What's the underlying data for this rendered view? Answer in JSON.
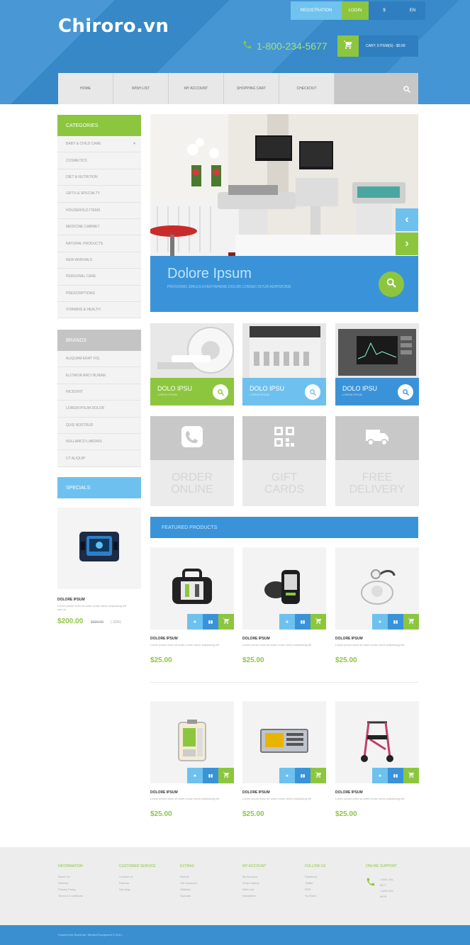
{
  "brand": "Chiroro.vn",
  "topbar": {
    "register": "REGISTRATION",
    "login": "LOGIN",
    "currency": "$",
    "language": "EN"
  },
  "header": {
    "phone": "1-800-234-5677",
    "cart_summary": "CART: 0 ITEM(S) - $0.00"
  },
  "nav": {
    "items": [
      "HOME",
      "WISH LIST",
      "MY ACCOUNT",
      "SHOPPING CART",
      "CHECKOUT"
    ]
  },
  "categories": {
    "title": "CATEGORIES",
    "items": [
      "BABY & CHILD CARE",
      "COSMETICS",
      "DIET & NUTRITION",
      "GIFTS & SPECIALTY",
      "HOUSEHOLD ITEMS",
      "MEDICINE CABINET",
      "NATURAL PRODUCTS",
      "NEW ARRIVALS",
      "PERSONAL CARE",
      "PRESCRIPTIONS",
      "VITAMINS & HEALTH"
    ]
  },
  "brands": {
    "title": "BRANDS",
    "items": [
      "ALIQUAM ERAT VOL",
      "ELITNIOR ANCI NUNAM",
      "INCIDUNT",
      "LOREM IPSUM DOLOR",
      "QUIS NOSTRUD",
      "NULLAMCO LABORIS",
      "UT ALIQUIP"
    ]
  },
  "specials": {
    "title": "SPECIALS",
    "name": "DOLORE IPSUM",
    "desc": "Lorem ipsum dolor sit amet conse ctetur adipisicing elit sed do",
    "price": "$200.00",
    "old_price": "$300.00",
    "discount": "(-33%)"
  },
  "slider": {
    "title": "Dolore Ipsum",
    "subtitle": "PROVIDING SMILES EVERYWHERE DOLOR CONSECTETUR ADIPISICING",
    "prev": "‹",
    "next": "›"
  },
  "banners": [
    {
      "title": "DOLO IPSU",
      "sub": "LOREM IPSUM",
      "color": "#8cc63f"
    },
    {
      "title": "DOLO IPSU",
      "sub": "LOREM IPSUM",
      "color": "#6ec1ee"
    },
    {
      "title": "DOLO IPSU",
      "sub": "LOREM IPSUM",
      "color": "#3a93d8"
    }
  ],
  "services": [
    {
      "line1": "ORDER",
      "line2": "ONLINE",
      "icon": "phone-icon"
    },
    {
      "line1": "GIFT",
      "line2": "CARDS",
      "icon": "qr-code-icon"
    },
    {
      "line1": "FREE",
      "line2": "DELIVERY",
      "icon": "truck-icon"
    }
  ],
  "featured": {
    "title": "FEATURED PRODUCTS",
    "products": [
      {
        "name": "DOLORE IPSUM",
        "desc": "Lorem ipsum dolor sit amet conse ctetur adipisicing elit",
        "price": "$25.00",
        "icon": "medical-bag-icon"
      },
      {
        "name": "DOLORE IPSUM",
        "desc": "Lorem ipsum dolor sit amet conse ctetur adipisicing elit",
        "price": "$25.00",
        "icon": "blood-pressure-monitor-icon"
      },
      {
        "name": "DOLORE IPSUM",
        "desc": "Lorem ipsum dolor sit amet conse ctetur adipisicing elit",
        "price": "$25.00",
        "icon": "breast-pump-icon"
      },
      {
        "name": "DOLORE IPSUM",
        "desc": "Lorem ipsum dolor sit amet conse ctetur adipisicing elit",
        "price": "$25.00",
        "icon": "infusion-pump-icon"
      },
      {
        "name": "DOLORE IPSUM",
        "desc": "Lorem ipsum dolor sit amet conse ctetur adipisicing elit",
        "price": "$25.00",
        "icon": "monitor-device-icon"
      },
      {
        "name": "DOLORE IPSUM",
        "desc": "Lorem ipsum dolor sit amet conse ctetur adipisicing elit",
        "price": "$25.00",
        "icon": "rollator-icon"
      }
    ]
  },
  "footer": {
    "columns": [
      {
        "title": "INFORMATION",
        "links": [
          "About Us",
          "Delivery",
          "Privacy Policy",
          "Terms & Conditions"
        ]
      },
      {
        "title": "CUSTOMER SERVICE",
        "links": [
          "Contact Us",
          "Returns",
          "Site Map"
        ]
      },
      {
        "title": "EXTRAS",
        "links": [
          "Brands",
          "Gift Vouchers",
          "Affiliates",
          "Specials"
        ]
      },
      {
        "title": "MY ACCOUNT",
        "links": [
          "My Account",
          "Order History",
          "Wish List",
          "Newsletter"
        ]
      },
      {
        "title": "FOLLOW US",
        "links": [
          "Facebook",
          "Twitter",
          "RSS",
          "YouTube"
        ]
      }
    ],
    "support": {
      "title": "ONLINE SUPPORT",
      "phone1": "1-800-234-5677",
      "phone2": "1-800-234-5678"
    },
    "copyright": "Powered by OpenCart. Medical Equipment © 2014"
  },
  "colors": {
    "green": "#8cc63f",
    "blue": "#3a93d8",
    "sky": "#6ec1ee",
    "gray": "#c4c4c4"
  }
}
